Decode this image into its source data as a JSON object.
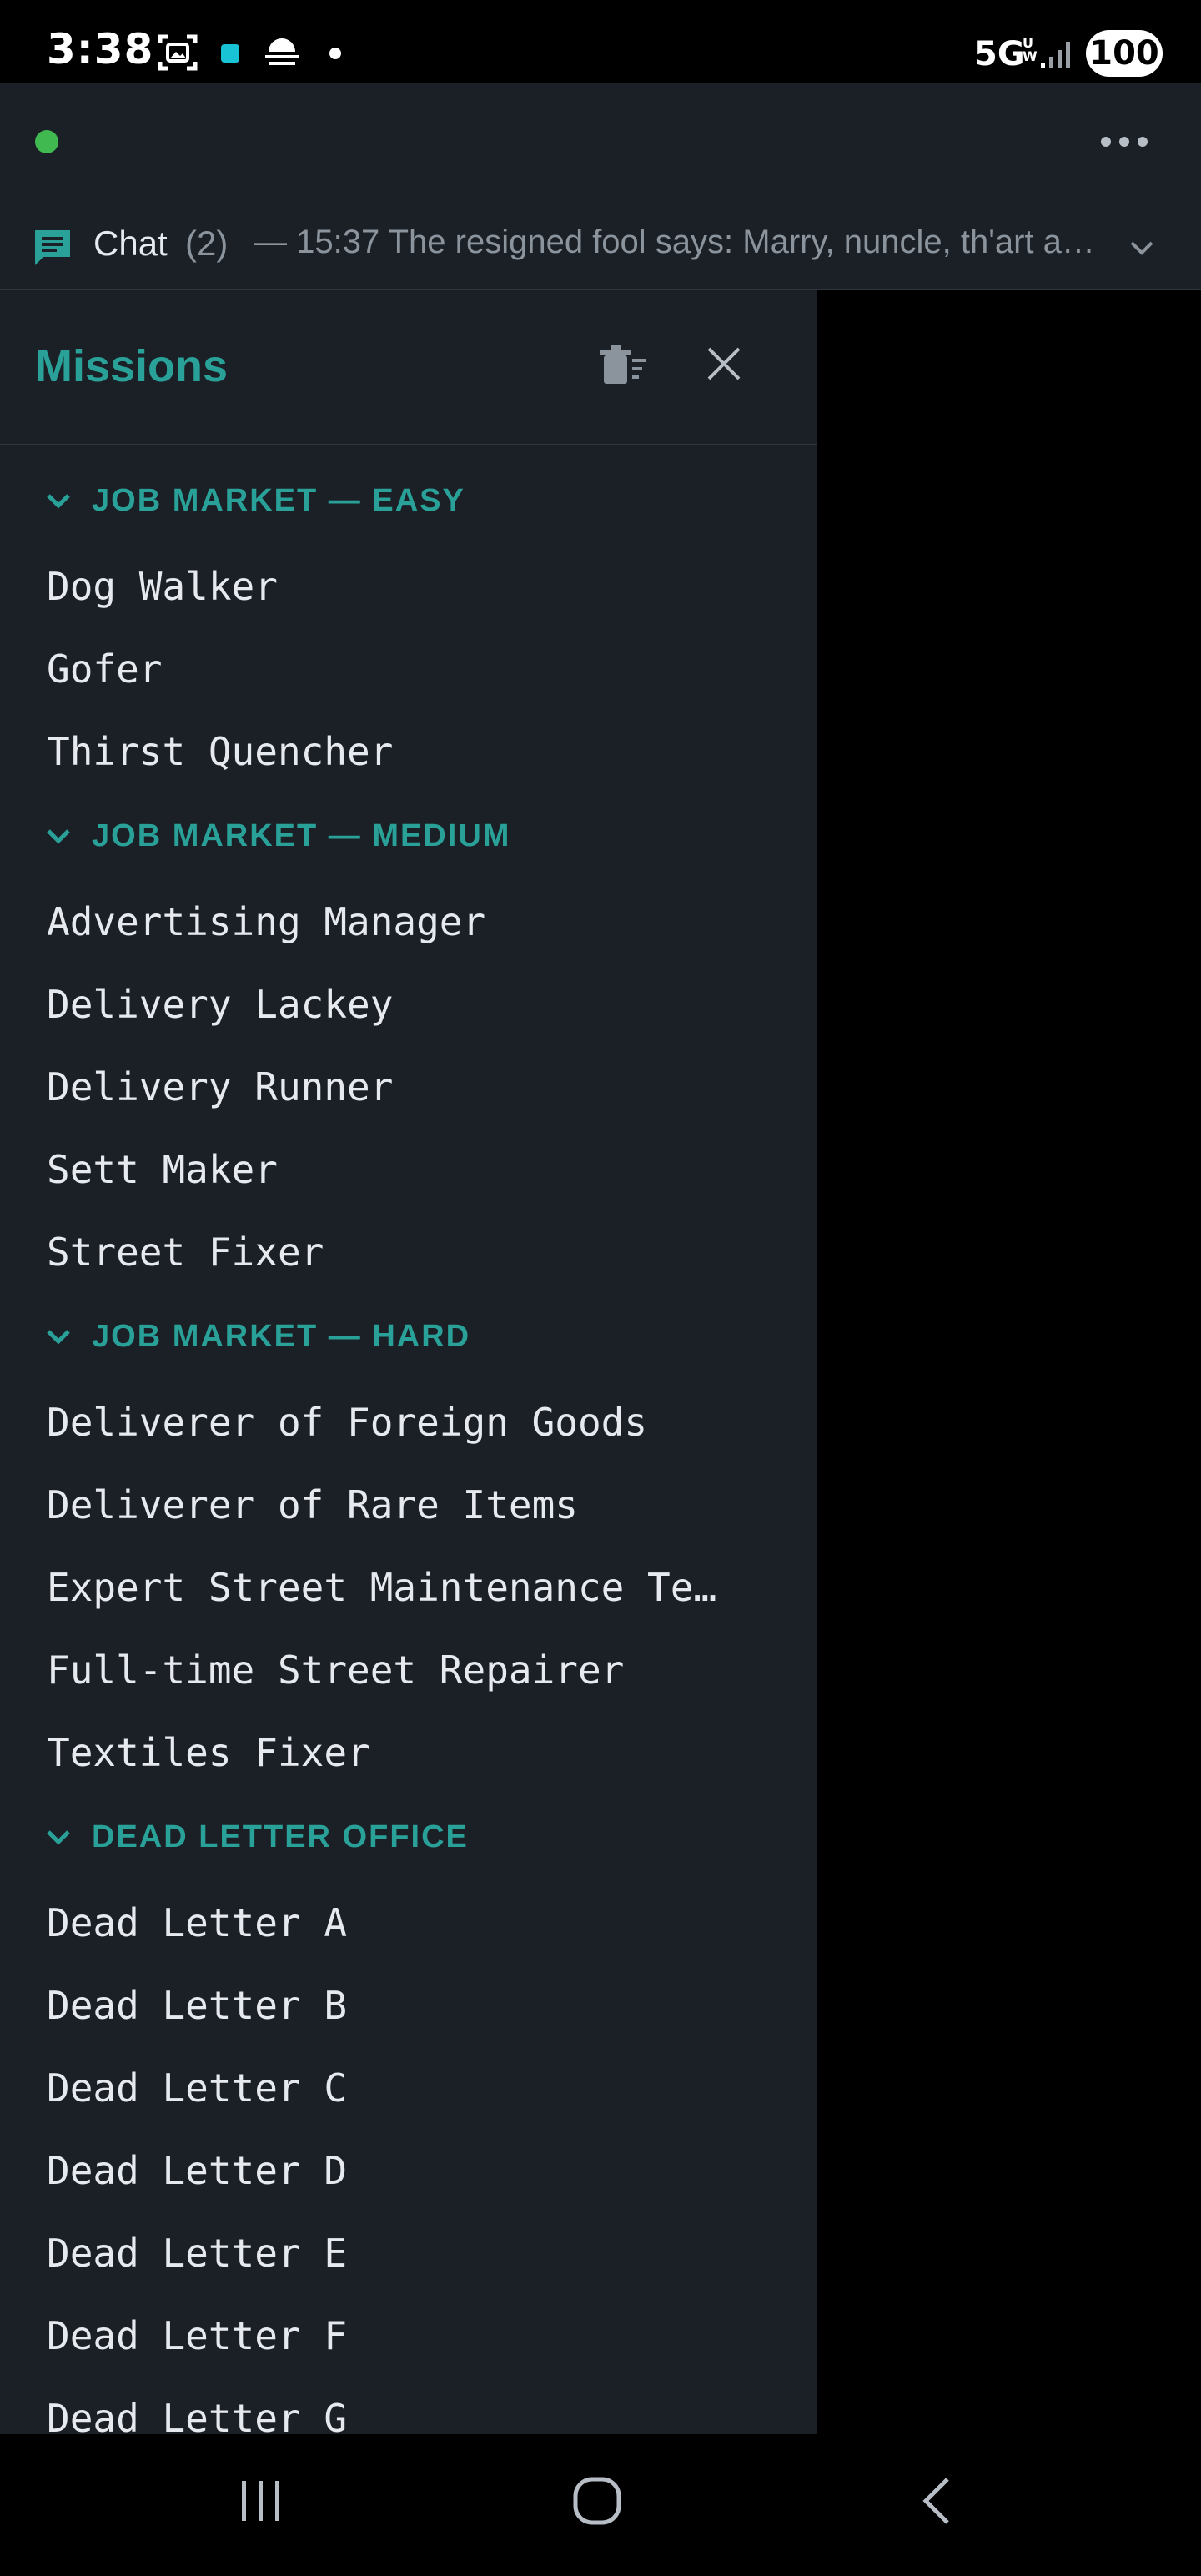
{
  "status_bar": {
    "time": "3:38",
    "network": "5G",
    "network_sub": "UW",
    "battery": "100",
    "icons": [
      "screenshot-icon",
      "app-notification-icon",
      "weather-icon",
      "dot-icon",
      "signal-icon"
    ]
  },
  "top_bar": {
    "online_status_color": "#3fb950",
    "more_icon": "more-horizontal-icon"
  },
  "chat": {
    "icon": "chat-icon",
    "label": "Chat",
    "count": "(2)",
    "preview": "— 15:37 The resigned fool says: Marry, nuncle, th'art a…",
    "expand_icon": "chevron-down-icon"
  },
  "missions": {
    "title": "Missions",
    "clear_icon": "clear-list-icon",
    "close_icon": "close-icon",
    "sections": [
      {
        "title": "JOB MARKET — EASY",
        "items": [
          "Dog Walker",
          "Gofer",
          "Thirst Quencher"
        ]
      },
      {
        "title": "JOB MARKET — MEDIUM",
        "items": [
          "Advertising Manager",
          "Delivery Lackey",
          "Delivery Runner",
          "Sett Maker",
          "Street Fixer"
        ]
      },
      {
        "title": "JOB MARKET — HARD",
        "items": [
          "Deliverer of Foreign Goods",
          "Deliverer of Rare Items",
          "Expert Street Maintenance Te…",
          "Full-time Street Repairer",
          "Textiles Fixer"
        ]
      },
      {
        "title": "DEAD LETTER OFFICE",
        "items": [
          "Dead Letter A",
          "Dead Letter B",
          "Dead Letter C",
          "Dead Letter D",
          "Dead Letter E",
          "Dead Letter F",
          "Dead Letter G"
        ]
      }
    ]
  },
  "nav_bar": {
    "icons": [
      "recent-apps-icon",
      "home-icon",
      "back-icon"
    ]
  },
  "colors": {
    "accent": "#2aa198",
    "panel": "#1b2027",
    "text": "#e6e9ed",
    "muted": "#8b939c"
  }
}
